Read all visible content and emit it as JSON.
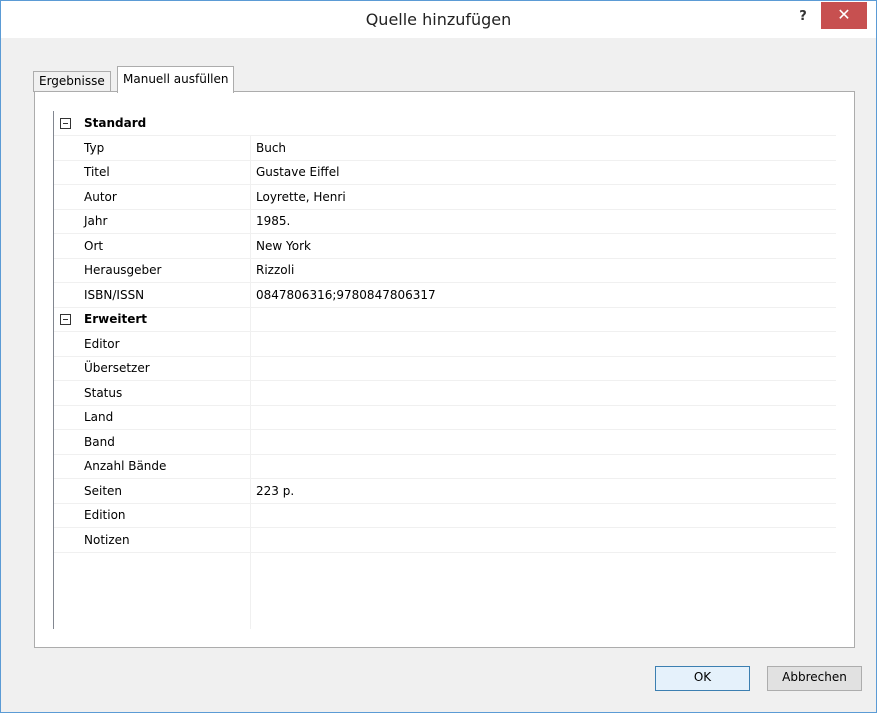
{
  "window": {
    "title": "Quelle hinzufügen",
    "help_label": "?",
    "close_label": "✕"
  },
  "tabs": [
    {
      "label": "Ergebnisse",
      "active": false
    },
    {
      "label": "Manuell ausfüllen",
      "active": true
    }
  ],
  "categories": [
    {
      "label": "Standard",
      "expanded": true,
      "properties": [
        {
          "name": "Typ",
          "value": "Buch"
        },
        {
          "name": "Titel",
          "value": "Gustave Eiffel"
        },
        {
          "name": "Autor",
          "value": "Loyrette, Henri"
        },
        {
          "name": "Jahr",
          "value": "1985."
        },
        {
          "name": "Ort",
          "value": "New York"
        },
        {
          "name": "Herausgeber",
          "value": "Rizzoli"
        },
        {
          "name": "ISBN/ISSN",
          "value": "0847806316;9780847806317"
        }
      ]
    },
    {
      "label": "Erweitert",
      "expanded": true,
      "properties": [
        {
          "name": "Editor",
          "value": ""
        },
        {
          "name": "Übersetzer",
          "value": ""
        },
        {
          "name": "Status",
          "value": ""
        },
        {
          "name": "Land",
          "value": ""
        },
        {
          "name": "Band",
          "value": ""
        },
        {
          "name": "Anzahl Bände",
          "value": ""
        },
        {
          "name": "Seiten",
          "value": "223 p."
        },
        {
          "name": "Edition",
          "value": ""
        },
        {
          "name": "Notizen",
          "value": ""
        }
      ]
    }
  ],
  "buttons": {
    "ok_label": "OK",
    "cancel_label": "Abbrechen"
  },
  "colors": {
    "close_button": "#c75050",
    "window_border": "#5b9bd5",
    "ok_border": "#3c7fb1"
  }
}
